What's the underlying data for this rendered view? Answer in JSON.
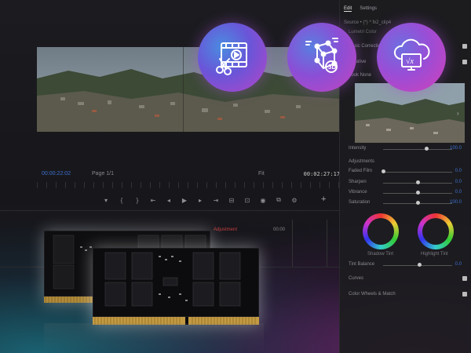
{
  "editor": {
    "timecode_left": "00:00:22:02",
    "page_label": "Page 1/1",
    "fit_label": "Fit",
    "timecode_right": "00:02:27:17",
    "timeline_label_red": "Adjustment",
    "timeline_label_right": "00:00"
  },
  "transport": {
    "icons": [
      "marker-icon",
      "in-point-icon",
      "out-point-icon",
      "go-to-in-icon",
      "step-back-icon",
      "play-icon",
      "step-forward-icon",
      "go-to-out-icon",
      "insert-icon",
      "overwrite-icon",
      "camera-icon",
      "compare-icon",
      "settings-icon"
    ],
    "symbols": [
      "▾",
      "{",
      "}",
      "⇤",
      "◂",
      "▶",
      "▸",
      "⇥",
      "⊟",
      "⊡",
      "◉",
      "⧉",
      "⚙"
    ],
    "add_symbol": "+"
  },
  "right_panel": {
    "tabs": [
      "Edit",
      "Settings"
    ],
    "active_tab": "Edit",
    "source_label": "Source • (*) * fx2_clip4",
    "source_link": "(*) * fx2_clip4",
    "effect_title": "Lumetri Color",
    "rows": [
      {
        "label": "Basic Correction",
        "checked": true
      },
      {
        "label": "Creative",
        "checked": true
      },
      {
        "label": "Look    None",
        "checked": false
      }
    ],
    "sliders": [
      {
        "label": "Intensity",
        "value": "100.0",
        "fraction": 0.62
      },
      {
        "label": "Adjustments",
        "value": "",
        "fraction": -1
      },
      {
        "label": "Faded Film",
        "value": "0.0",
        "fraction": 0.0
      },
      {
        "label": "Sharpen",
        "value": "0.0",
        "fraction": 0.5
      },
      {
        "label": "Vibrance",
        "value": "0.0",
        "fraction": 0.5
      },
      {
        "label": "Saturation",
        "value": "100.0",
        "fraction": 0.5
      }
    ],
    "wheel_labels": [
      "Shadow Tint",
      "Highlight Tint"
    ],
    "tint_balance_label": "Tint Balance",
    "tint_balance_value": "0.0",
    "bottom_rows": [
      "Curves",
      "Color Wheels & Match"
    ]
  },
  "icons": [
    "video-edit-icon",
    "3d-cube-icon",
    "cloud-computing-icon"
  ],
  "colors": {
    "accent_blue": "#3e6fd0",
    "glow_teal": "#1ea0b4",
    "glow_magenta": "#aa2896"
  }
}
